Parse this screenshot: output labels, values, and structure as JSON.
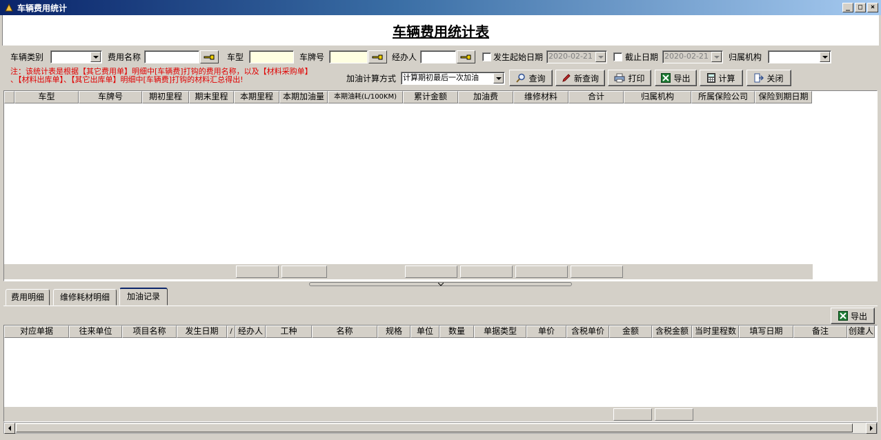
{
  "window": {
    "title": "车辆费用统计",
    "buttons": [
      "_",
      "□",
      "×"
    ]
  },
  "report_title": "车辆费用统计表",
  "filters": {
    "vehicle_type_label": "车辆类别",
    "vehicle_type_value": "",
    "fee_name_label": "费用名称",
    "fee_name_value": "",
    "model_label": "车型",
    "model_value": "",
    "plate_label": "车牌号",
    "plate_value": "",
    "handler_label": "经办人",
    "handler_value": "",
    "start_date_label": "发生起始日期",
    "start_date_value": "2020-02-21",
    "end_date_label": "截止日期",
    "end_date_value": "2020-02-21",
    "org_label": "归属机构",
    "org_value": "",
    "calc_mode_label": "加油计算方式",
    "calc_mode_value": "计算期初最后一次加油"
  },
  "note": {
    "line1": "注：该统计表是根据【其它费用单】明细中[车辆费]打钩的费用名称，以及【材料采购单】",
    "line2": "、【材料出库单】、【其它出库单】明细中[车辆费]打钩的材料汇总得出!"
  },
  "toolbar": {
    "query": "查询",
    "new_query": "新查询",
    "print": "打印",
    "export": "导出",
    "calculate": "计算",
    "close": "关闭"
  },
  "main_grid": {
    "columns": [
      "车型",
      "车牌号",
      "期初里程",
      "期末里程",
      "本期里程",
      "本期加油量",
      "本期油耗(L/100KM)",
      "累计金额",
      "加油费",
      "维修材料",
      "合计",
      "归属机构",
      "所属保险公司",
      "保险到期日期"
    ],
    "rows": []
  },
  "tabs": [
    "费用明细",
    "维修耗材明细",
    "加油记录"
  ],
  "active_tab": "加油记录",
  "detail_export": "导出",
  "detail_grid": {
    "columns": [
      "对应单据",
      "往来单位",
      "项目名称",
      "发生日期",
      "/",
      "经办人",
      "工种",
      "名称",
      "规格",
      "单位",
      "数量",
      "单据类型",
      "单价",
      "含税单价",
      "金额",
      "含税金额",
      "当时里程数",
      "填写日期",
      "备注",
      "创建人"
    ],
    "rows": []
  },
  "colors": {
    "titlebar_start": "#0a246a",
    "note_red": "#e00000",
    "face": "#d4d0c8"
  }
}
